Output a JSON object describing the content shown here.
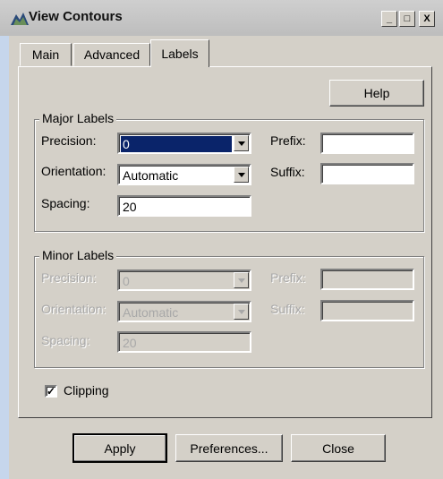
{
  "window": {
    "title": "View Contours",
    "controls": {
      "minimize": "_",
      "maximize": "□",
      "close": "X"
    }
  },
  "tabs": [
    {
      "label": "Main",
      "active": false
    },
    {
      "label": "Advanced",
      "active": false
    },
    {
      "label": "Labels",
      "active": true
    }
  ],
  "help_label": "Help",
  "major": {
    "legend": "Major Labels",
    "precision_label": "Precision:",
    "precision_value": "0",
    "orientation_label": "Orientation:",
    "orientation_value": "Automatic",
    "spacing_label": "Spacing:",
    "spacing_value": "20",
    "prefix_label": "Prefix:",
    "prefix_value": "",
    "suffix_label": "Suffix:",
    "suffix_value": ""
  },
  "minor": {
    "legend": "Minor Labels",
    "precision_label": "Precision:",
    "precision_value": "0",
    "orientation_label": "Orientation:",
    "orientation_value": "Automatic",
    "spacing_label": "Spacing:",
    "spacing_value": "20",
    "prefix_label": "Prefix:",
    "prefix_value": "",
    "suffix_label": "Suffix:",
    "suffix_value": ""
  },
  "clipping": {
    "label": "Clipping",
    "checked": true,
    "mark": "✓"
  },
  "footer": {
    "apply": "Apply",
    "preferences": "Preferences...",
    "close": "Close"
  },
  "colors": {
    "selection": "#0a246a",
    "face": "#d4d0c8"
  }
}
